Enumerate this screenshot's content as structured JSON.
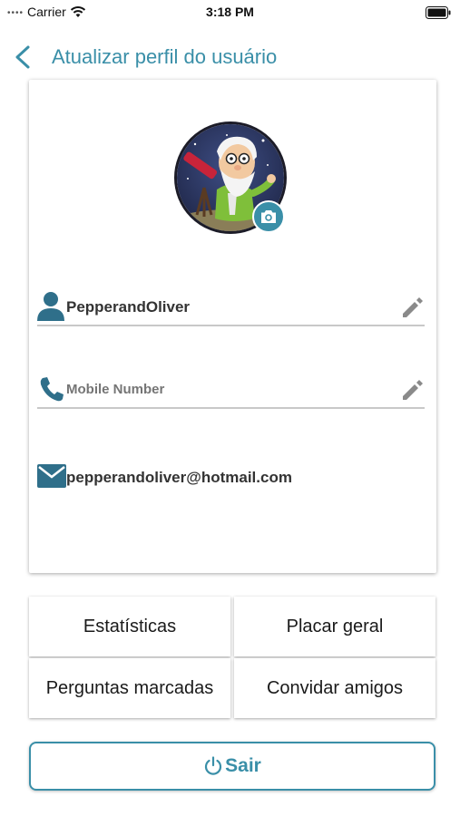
{
  "status_bar": {
    "carrier": "Carrier",
    "time": "3:18 PM"
  },
  "header": {
    "title": "Atualizar perfil do usuário"
  },
  "profile": {
    "avatar_icon": "astronomer-avatar",
    "username": "PepperandOliver",
    "mobile_placeholder": "Mobile Number",
    "email": "pepperandoliver@hotmail.com"
  },
  "menu": {
    "stats": "Estatísticas",
    "leaderboard": "Placar geral",
    "bookmarked": "Perguntas marcadas",
    "invite": "Convidar amigos"
  },
  "logout_label": "Sair",
  "colors": {
    "accent": "#3a8fa8",
    "icon": "#2f6f8a",
    "divider": "#c8c8c8"
  }
}
